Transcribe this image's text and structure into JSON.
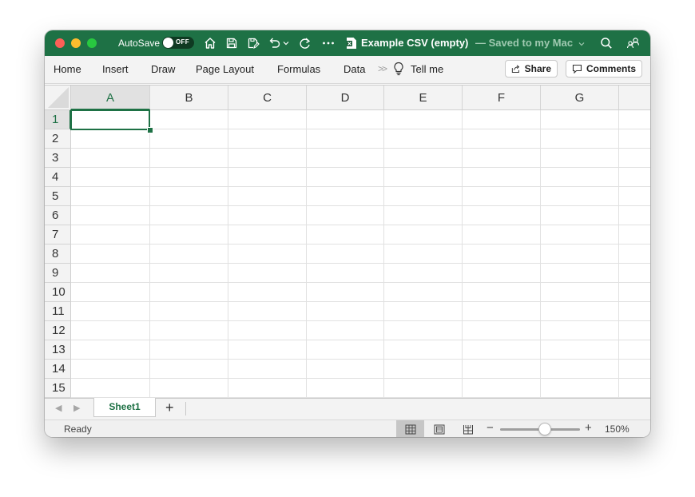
{
  "window": {
    "autosave_label": "AutoSave",
    "autosave_state": "OFF",
    "doc_title": "Example CSV (empty)",
    "doc_subtitle": "— Saved to my Mac",
    "accent_color": "#1e7145"
  },
  "ribbon": {
    "tabs": [
      "Home",
      "Insert",
      "Draw",
      "Page Layout",
      "Formulas",
      "Data"
    ],
    "more_glyph": ">>",
    "tell_me": "Tell me",
    "share_label": "Share",
    "comments_label": "Comments"
  },
  "grid": {
    "columns": [
      "A",
      "B",
      "C",
      "D",
      "E",
      "F",
      "G"
    ],
    "rows": [
      "1",
      "2",
      "3",
      "4",
      "5",
      "6",
      "7",
      "8",
      "9",
      "10",
      "11",
      "12",
      "13",
      "14",
      "15"
    ],
    "selected_cell": "A1"
  },
  "sheets": {
    "tabs": [
      "Sheet1"
    ],
    "add_label": "+"
  },
  "status": {
    "text": "Ready",
    "zoom": "150%",
    "zoom_minus": "−",
    "zoom_plus": "+"
  }
}
